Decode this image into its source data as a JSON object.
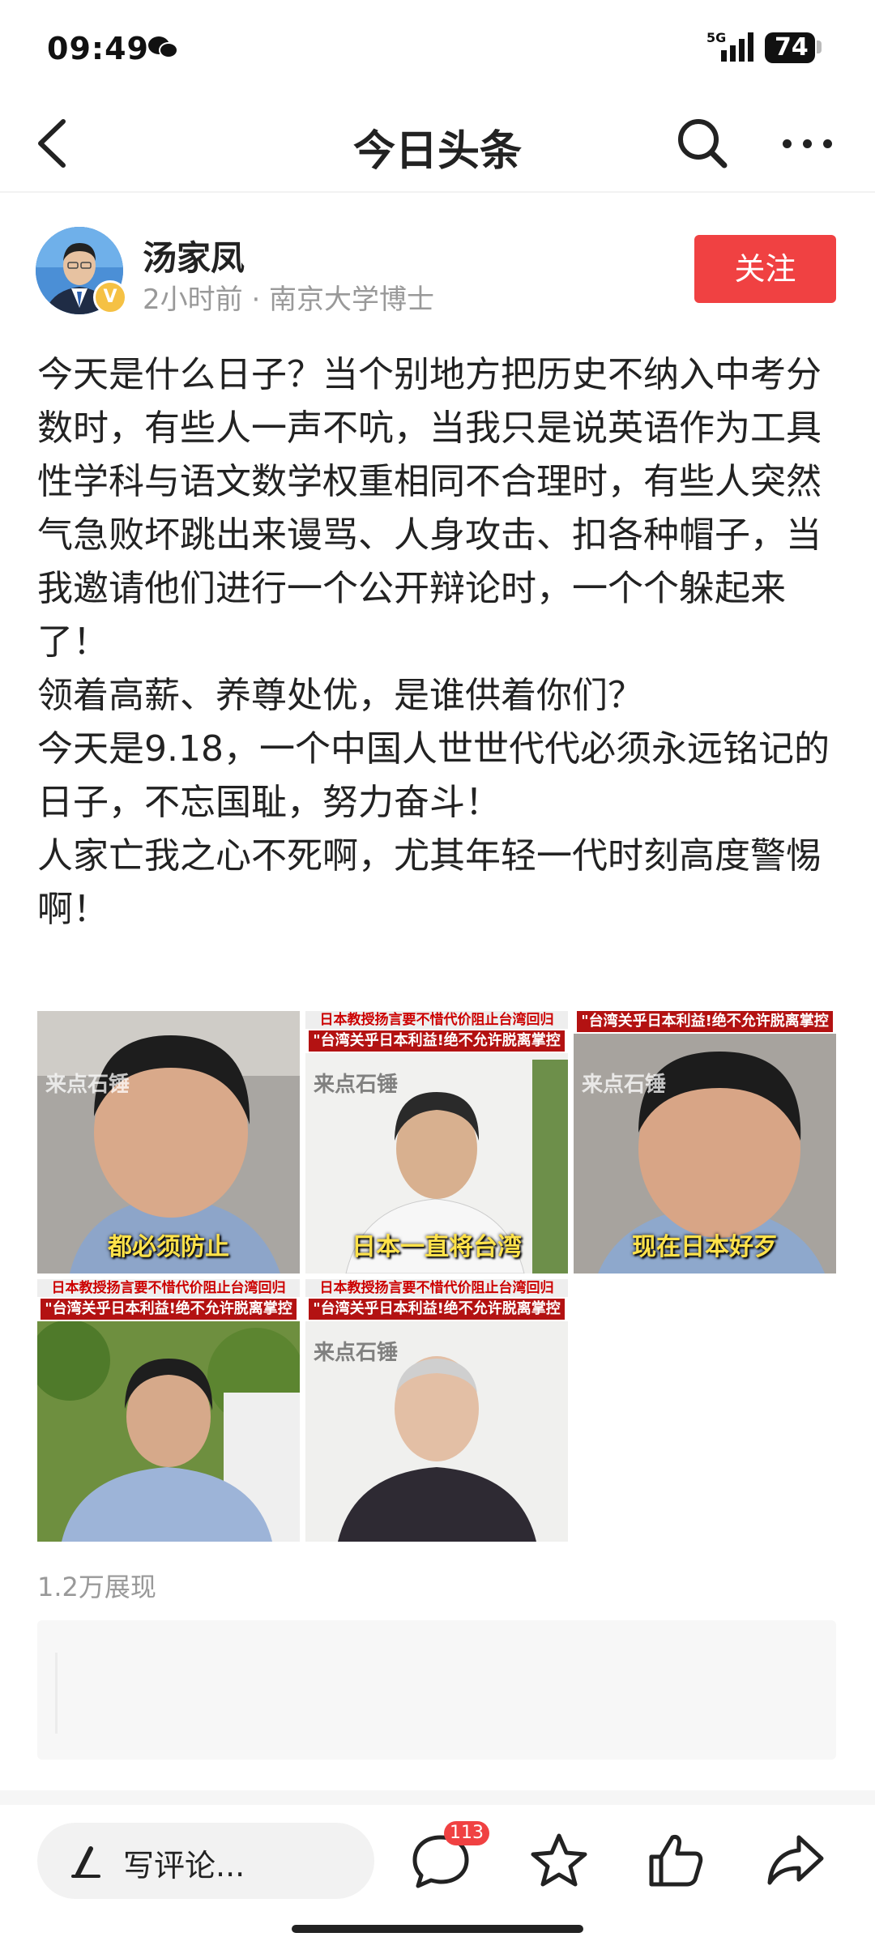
{
  "status_bar": {
    "time": "09:49",
    "network": "5G",
    "battery": "74"
  },
  "nav": {
    "title": "今日头条"
  },
  "author": {
    "name": "汤家凤",
    "meta": "2小时前 · 南京大学博士",
    "badge": "V",
    "follow_label": "关注"
  },
  "article": {
    "paragraphs": [
      "今天是什么日子？当个别地方把历史不纳入中考分数时，有些人一声不吭，当我只是说英语作为工具性学科与语文数学权重相同不合理时，有些人突然气急败坏跳出来谩骂、人身攻击、扣各种帽子，当我邀请他们进行一个公开辩论时，一个个躲起来了！",
      "领着高薪、养尊处优，是谁供着你们？",
      "今天是9.18，一个中国人世世代代必须永远铭记的日子，不忘国耻，努力奋斗！",
      "人家亡我之心不死啊，尤其年轻一代时刻高度警惕啊！"
    ]
  },
  "images": [
    {
      "banner_top": "",
      "banner": "",
      "caption": "都必须防止",
      "watermark": "来点石锤"
    },
    {
      "banner_top": "日本教授扬言要不惜代价阻止台湾回归",
      "banner": "\"台湾关乎日本利益!绝不允许脱离掌控",
      "caption": "日本一直将台湾",
      "watermark": "来点石锤"
    },
    {
      "banner_top": "",
      "banner": "\"台湾关乎日本利益!绝不允许脱离掌控",
      "caption": "现在日本好歹",
      "watermark": "来点石锤"
    },
    {
      "banner_top": "日本教授扬言要不惜代价阻止台湾回归",
      "banner": "\"台湾关乎日本利益!绝不允许脱离掌控",
      "caption": "",
      "watermark": ""
    },
    {
      "banner_top": "日本教授扬言要不惜代价阻止台湾回归",
      "banner": "\"台湾关乎日本利益!绝不允许脱离掌控",
      "caption": "",
      "watermark": "来点石锤"
    }
  ],
  "stats": {
    "views": "1.2万展现"
  },
  "bottom_bar": {
    "comment_placeholder": "写评论...",
    "comment_count": "113"
  },
  "colors": {
    "accent": "#f04142",
    "text": "#222222",
    "muted": "#999999"
  }
}
